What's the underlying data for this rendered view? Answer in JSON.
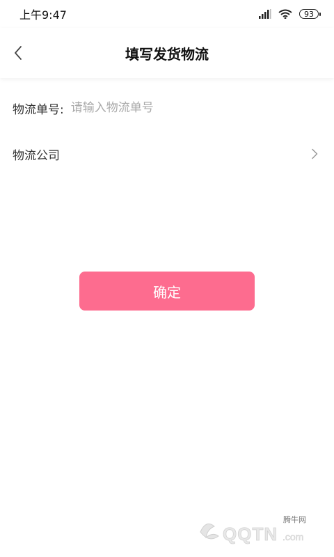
{
  "status_bar": {
    "time": "上午9:47",
    "battery": "93",
    "icons": [
      "signal-icon",
      "wifi-icon",
      "battery-icon"
    ]
  },
  "header": {
    "title": "填写发货物流",
    "back_icon": "chevron-left-icon"
  },
  "form": {
    "tracking_label": "物流单号:",
    "tracking_placeholder": "请输入物流单号",
    "tracking_value": "",
    "company_label": "物流公司",
    "company_icon": "chevron-right-icon"
  },
  "actions": {
    "confirm_label": "确定"
  },
  "watermark": {
    "brand_text": "QQTN.com",
    "site_label": "腾牛网"
  },
  "colors": {
    "accent": "#fd6c8f",
    "placeholder": "#aaaaaa",
    "background": "#ffffff"
  }
}
